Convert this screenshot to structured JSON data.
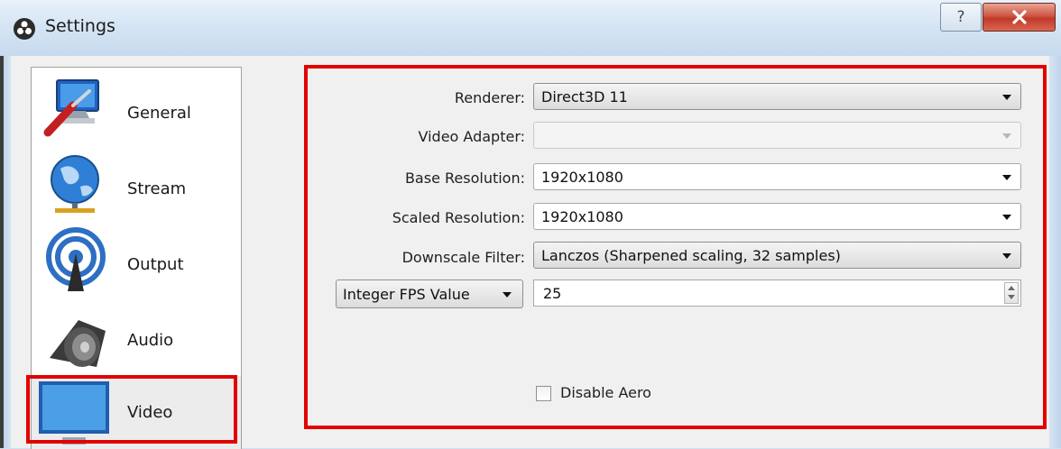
{
  "window": {
    "title": "Settings",
    "help_glyph": "?",
    "close_glyph": "x",
    "icon": "obs-logo-icon"
  },
  "sidebar": {
    "items": [
      {
        "label": "General",
        "icon": "general-tools-icon"
      },
      {
        "label": "Stream",
        "icon": "stream-globe-icon"
      },
      {
        "label": "Output",
        "icon": "output-antenna-icon"
      },
      {
        "label": "Audio",
        "icon": "audio-speaker-icon"
      },
      {
        "label": "Video",
        "icon": "video-monitor-icon",
        "selected": true
      }
    ]
  },
  "video": {
    "renderer": {
      "label": "Renderer:",
      "value": "Direct3D 11"
    },
    "video_adapter": {
      "label": "Video Adapter:",
      "value": ""
    },
    "base_resolution": {
      "label": "Base Resolution:",
      "value": "1920x1080"
    },
    "scaled_resolution": {
      "label": "Scaled Resolution:",
      "value": "1920x1080"
    },
    "downscale_filter": {
      "label": "Downscale Filter:",
      "value": "Lanczos (Sharpened scaling, 32 samples)"
    },
    "fps_type": {
      "value": "Integer FPS Value"
    },
    "fps_value": {
      "value": "25"
    },
    "disable_aero": {
      "label": "Disable Aero",
      "checked": false
    }
  },
  "colors": {
    "highlight_outline": "#e30000",
    "titlebar": "#d6e5f4",
    "close_button": "#c0392b"
  }
}
